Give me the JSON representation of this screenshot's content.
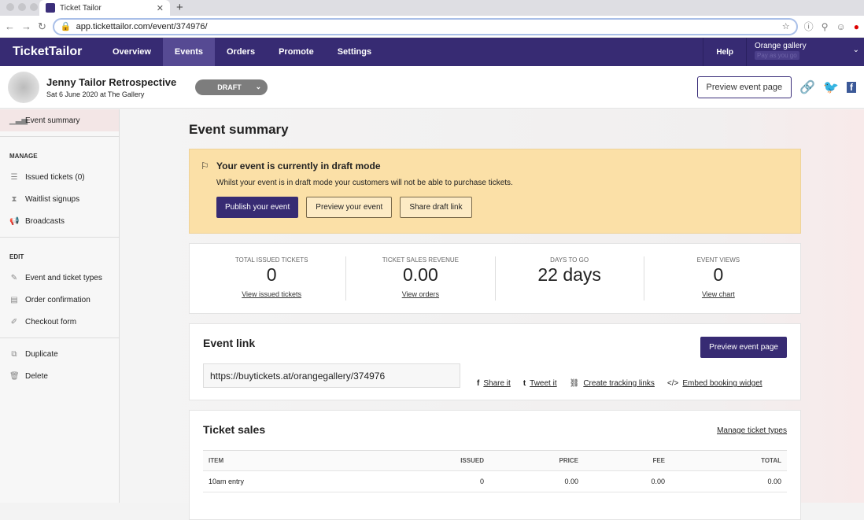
{
  "browser": {
    "tab_title": "Ticket Tailor",
    "url": "app.tickettailor.com/event/374976/"
  },
  "nav": {
    "logo": "TicketTailor",
    "items": [
      "Overview",
      "Events",
      "Orders",
      "Promote",
      "Settings"
    ],
    "help": "Help",
    "account": "Orange gallery",
    "plan": "Pay as you go"
  },
  "event": {
    "title": "Jenny Tailor Retrospective",
    "date": "Sat 6 June 2020 at The Gallery",
    "status": "DRAFT",
    "preview": "Preview event page"
  },
  "sidebar": {
    "summary": "Event summary",
    "manage_heading": "MANAGE",
    "manage": [
      "Issued tickets (0)",
      "Waitlist signups",
      "Broadcasts"
    ],
    "edit_heading": "EDIT",
    "edit": [
      "Event and ticket types",
      "Order confirmation",
      "Checkout form"
    ],
    "other": [
      "Duplicate",
      "Delete"
    ]
  },
  "main": {
    "title": "Event summary",
    "banner": {
      "title": "Your event is currently in draft mode",
      "desc": "Whilst your event is in draft mode your customers will not be able to purchase tickets.",
      "publish": "Publish your event",
      "preview": "Preview your event",
      "share": "Share draft link"
    },
    "stats": [
      {
        "label": "TOTAL ISSUED TICKETS",
        "value": "0",
        "link": "View issued tickets"
      },
      {
        "label": "TICKET SALES REVENUE",
        "value": "0.00",
        "link": "View orders"
      },
      {
        "label": "DAYS TO GO",
        "value": "22 days",
        "link": ""
      },
      {
        "label": "EVENT VIEWS",
        "value": "0",
        "link": "View chart"
      }
    ],
    "link": {
      "title": "Event link",
      "button": "Preview event page",
      "url": "https://buytickets.at/orangegallery/374976",
      "share": "Share it",
      "tweet": "Tweet it",
      "tracking": "Create tracking links",
      "embed": "Embed booking widget"
    },
    "sales": {
      "title": "Ticket sales",
      "manage": "Manage ticket types",
      "headers": [
        "ITEM",
        "ISSUED",
        "PRICE",
        "FEE",
        "TOTAL"
      ],
      "rows": [
        [
          "10am entry",
          "0",
          "0.00",
          "0.00",
          "0.00"
        ]
      ]
    }
  }
}
